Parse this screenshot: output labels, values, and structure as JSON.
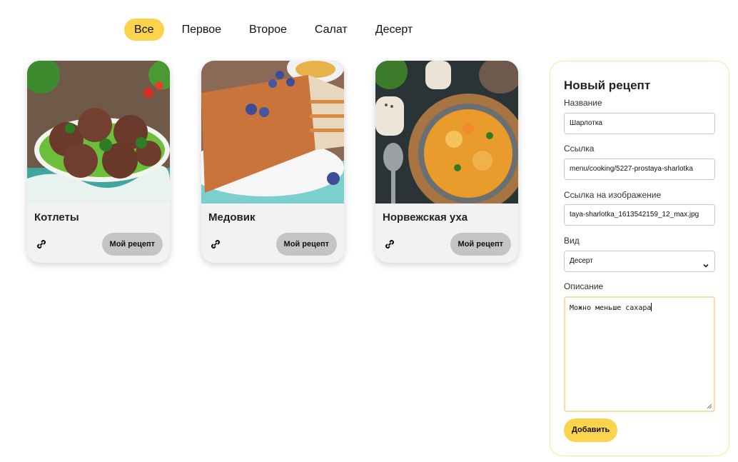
{
  "tabs": [
    {
      "label": "Все",
      "active": true
    },
    {
      "label": "Первое",
      "active": false
    },
    {
      "label": "Второе",
      "active": false
    },
    {
      "label": "Салат",
      "active": false
    },
    {
      "label": "Десерт",
      "active": false
    }
  ],
  "cards": [
    {
      "title": "Котлеты",
      "button": "Мой рецепт"
    },
    {
      "title": "Медовик",
      "button": "Мой рецепт"
    },
    {
      "title": "Норвежская уха",
      "button": "Мой рецепт"
    }
  ],
  "form": {
    "title": "Новый рецепт",
    "name_label": "Название",
    "name_value": "Шарлотка",
    "link_label": "Ссылка",
    "link_value": "menu/cooking/5227-prostaya-sharlotka",
    "image_label": "Ссылка на изображение",
    "image_value": "taya-sharlotka_1613542159_12_max.jpg",
    "type_label": "Вид",
    "type_value": "Десерт",
    "desc_label": "Описание",
    "desc_value": "Можно меньше сахара",
    "submit": "Добавить"
  },
  "colors": {
    "accent": "#fcd34d",
    "button_gray": "#c4c4c4",
    "card_bg": "#f2f2f2"
  }
}
